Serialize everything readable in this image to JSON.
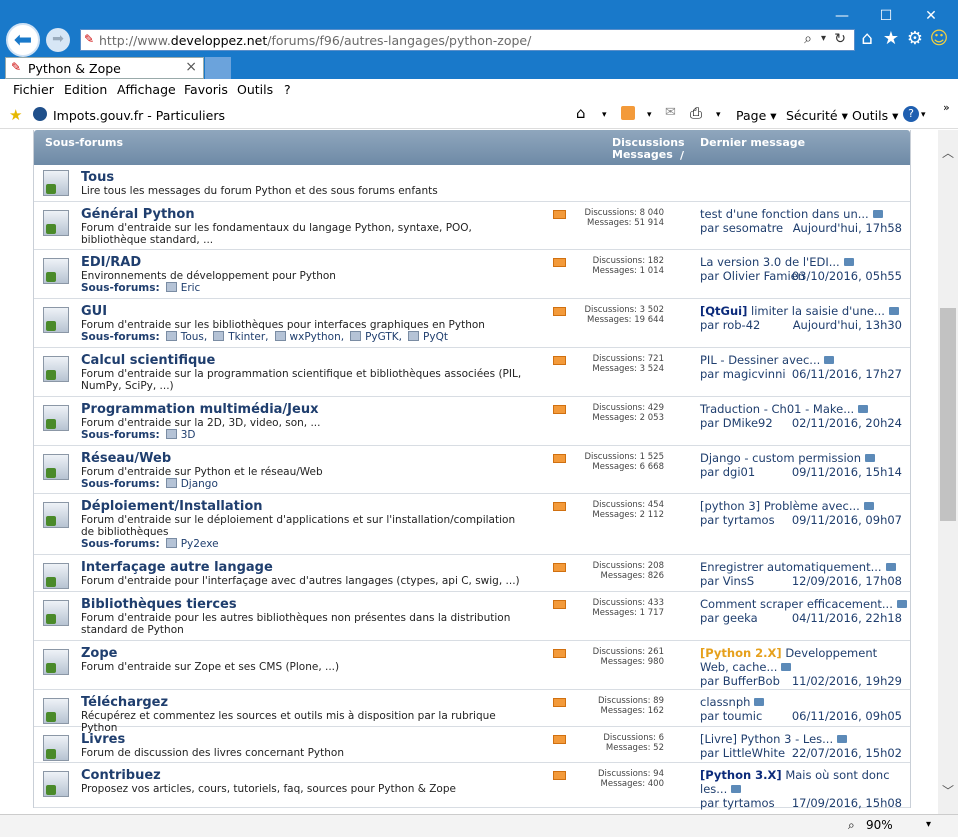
{
  "browser": {
    "address": {
      "prefix": "http://www.",
      "domain": "developpez.net",
      "path": "/forums/f96/autres-langages/python-zope/"
    },
    "tab_title": "Python & Zope",
    "tab_close": "×",
    "menus": [
      "Fichier",
      "Edition",
      "Affichage",
      "Favoris",
      "Outils",
      "?"
    ],
    "favorite_link": "Impots.gouv.fr - Particuliers",
    "commands": {
      "page": "Page ▾",
      "securite": "Sécurité ▾",
      "outils": "Outils ▾"
    },
    "zoom": "90%"
  },
  "table": {
    "col_subforums": "Sous-forums",
    "col_discussions_line1": "Discussions /",
    "col_discussions_line2": "Messages",
    "col_last": "Dernier message",
    "subs_label": "Sous-forums:",
    "by_prefix": "par "
  },
  "rows": [
    {
      "title": "Tous",
      "desc": "Lire tous les messages du forum Python et des sous forums enfants",
      "subs": [],
      "discussions": "",
      "messages": "",
      "tag": "",
      "topic": "",
      "by": "",
      "date": ""
    },
    {
      "title": "Général Python",
      "desc": "Forum d'entraide sur les fondamentaux du langage Python, syntaxe, POO, bibliothèque standard, ...",
      "subs": [],
      "discussions": "Discussions: 8 040",
      "messages": "Messages: 51 914",
      "tag": "",
      "topic": "test d'une fonction dans un...",
      "by": "sesomatre",
      "date": "Aujourd'hui, 17h58"
    },
    {
      "title": "EDI/RAD",
      "desc": "Environnements de développement pour Python",
      "subs": [
        "Eric"
      ],
      "discussions": "Discussions: 182",
      "messages": "Messages: 1 014",
      "tag": "",
      "topic": "La version 3.0 de l'EDI...",
      "by": "Olivier Famien",
      "date": "03/10/2016, 05h55"
    },
    {
      "title": "GUI",
      "desc": "Forum d'entraide sur les bibliothèques pour interfaces graphiques en Python",
      "subs": [
        "Tous,",
        "Tkinter,",
        "wxPython,",
        "PyGTK,",
        "PyQt"
      ],
      "discussions": "Discussions: 3 502",
      "messages": "Messages: 19 644",
      "tag": "[QtGui]",
      "topic": " limiter la saisie d'une...",
      "by": "rob-42",
      "date": "Aujourd'hui, 13h30"
    },
    {
      "title": "Calcul scientifique",
      "desc": "Forum d'entraide sur la programmation scientifique et bibliothèques associées (PIL, NumPy, SciPy, ...)",
      "subs": [],
      "discussions": "Discussions: 721",
      "messages": "Messages: 3 524",
      "tag": "",
      "topic": "PIL - Dessiner avec...",
      "by": "magicvinni",
      "date": "06/11/2016, 17h27"
    },
    {
      "title": "Programmation multimédia/Jeux",
      "desc": "Forum d'entraide sur la 2D, 3D, video, son, ...",
      "subs": [
        "3D"
      ],
      "discussions": "Discussions: 429",
      "messages": "Messages: 2 053",
      "tag": "",
      "topic": "Traduction - Ch01 - Make...",
      "by": "DMike92",
      "date": "02/11/2016, 20h24"
    },
    {
      "title": "Réseau/Web",
      "desc": "Forum d'entraide sur Python et le réseau/Web",
      "subs": [
        "Django"
      ],
      "discussions": "Discussions: 1 525",
      "messages": "Messages: 6 668",
      "tag": "",
      "topic": "Django - custom permission",
      "by": "dgi01",
      "date": "09/11/2016, 15h14"
    },
    {
      "title": "Déploiement/Installation",
      "desc": "Forum d'entraide sur le déploiement d'applications et sur l'installation/compilation de bibliothèques",
      "subs": [
        "Py2exe"
      ],
      "discussions": "Discussions: 454",
      "messages": "Messages: 2 112",
      "tag": "",
      "topic": "[python 3] Problème avec...",
      "by": "tyrtamos",
      "date": "09/11/2016, 09h07"
    },
    {
      "title": "Interfaçage autre langage",
      "desc": "Forum d'entraide pour l'interfaçage avec d'autres langages (ctypes, api C, swig, ...)",
      "subs": [],
      "discussions": "Discussions: 208",
      "messages": "Messages: 826",
      "tag": "",
      "topic": "Enregistrer automatiquement...",
      "by": "VinsS",
      "date": "12/09/2016, 17h08"
    },
    {
      "title": "Bibliothèques tierces",
      "desc": "Forum d'entraide pour les autres bibliothèques non présentes dans la distribution standard de Python",
      "subs": [],
      "discussions": "Discussions: 433",
      "messages": "Messages: 1 717",
      "tag": "",
      "topic": "Comment scraper efficacement...",
      "by": "geeka",
      "date": "04/11/2016, 22h18"
    },
    {
      "title": "Zope",
      "desc": "Forum d'entraide sur Zope et ses CMS (Plone, ...)",
      "subs": [],
      "discussions": "Discussions: 261",
      "messages": "Messages: 980",
      "tag": "[Python 2.X]",
      "topic": " Developpement Web, cache...",
      "by": "BufferBob",
      "date": "11/02/2016, 19h29"
    },
    {
      "title": "Téléchargez",
      "desc": "Récupérez et commentez les sources et outils mis à disposition par la rubrique Python",
      "subs": [],
      "discussions": "Discussions: 89",
      "messages": "Messages: 162",
      "tag": "",
      "topic": "classnph",
      "by": "toumic",
      "date": "06/11/2016, 09h05"
    },
    {
      "title": "Livres",
      "desc": "Forum de discussion des livres concernant Python",
      "subs": [],
      "discussions": "Discussions: 6",
      "messages": "Messages: 52",
      "tag": "",
      "topic": "[Livre] Python 3 - Les...",
      "by": "LittleWhite",
      "date": "22/07/2016, 15h02"
    },
    {
      "title": "Contribuez",
      "desc": "Proposez vos articles, cours, tutoriels, faq, sources pour Python & Zope",
      "subs": [],
      "discussions": "Discussions: 94",
      "messages": "Messages: 400",
      "tag": "[Python 3.X]",
      "topic": " Mais où sont donc les...",
      "by": "tyrtamos",
      "date": "17/09/2016, 15h08"
    }
  ],
  "colors": {
    "titlebar": "#1979ca",
    "header": "#7891aa",
    "link": "#1f3e6e",
    "tag_gold": "#e6a01c",
    "tag_navy": "#0b2a7a",
    "rss": "#f39a3a"
  }
}
